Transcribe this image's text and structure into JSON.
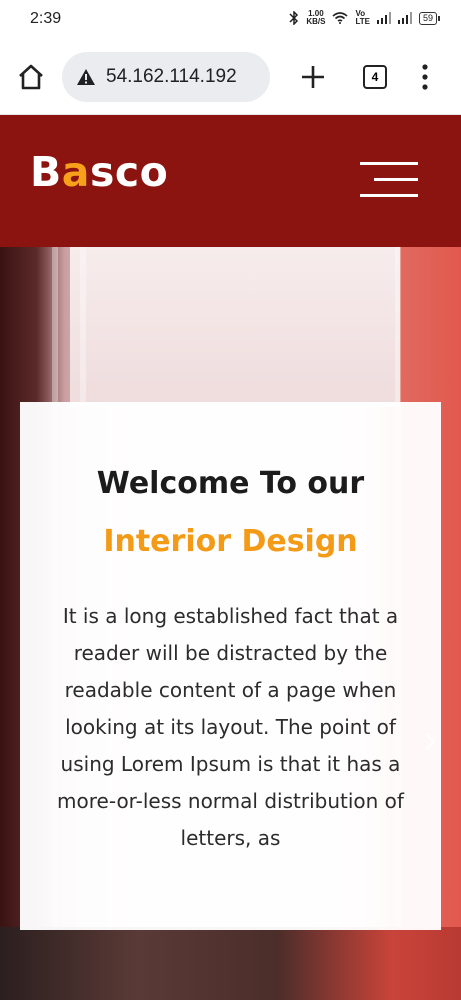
{
  "status_bar": {
    "time": "2:39",
    "net_speed_value": "1.00",
    "net_speed_unit": "KB/S",
    "volte_top": "Vo",
    "volte_bottom": "LTE",
    "battery": "59"
  },
  "browser": {
    "url": "54.162.114.192",
    "tab_count": "4"
  },
  "site": {
    "logo_prefix": "B",
    "logo_accent": "a",
    "logo_suffix": "sco",
    "header_color": "#8b1410",
    "accent_color": "#f39a17"
  },
  "hero": {
    "headline_line1": "Welcome To our",
    "headline_line2": "Interior Design",
    "body": "It is a long established fact that a reader will be distracted by the readable content of a page when looking at its layout. The point of using Lorem Ipsum is that it has a more-or-less normal distribution of letters, as"
  },
  "icons": [
    "bluetooth-icon",
    "wifi-icon",
    "signal-icon",
    "home-icon",
    "warning-icon",
    "plus-icon",
    "more-vert-icon",
    "hamburger-menu-icon",
    "chevron-right-icon"
  ]
}
